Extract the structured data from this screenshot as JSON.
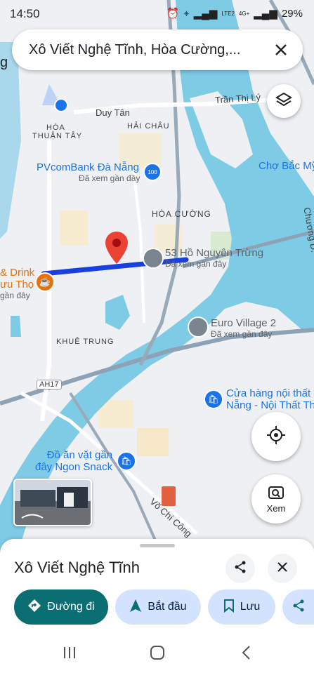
{
  "status": {
    "time": "14:50",
    "network": "LTE2",
    "network2": "4G+",
    "battery": "29%"
  },
  "search": {
    "query": "Xô Viết Nghệ Tĩnh, Hòa Cường,..."
  },
  "map": {
    "streets": [
      {
        "id": "duy-tan",
        "label": "Duy Tân"
      },
      {
        "id": "tran-thi-ly",
        "label": "Trần Thị Lý"
      },
      {
        "id": "vo-chi-cong",
        "label": "Võ Chí Công"
      },
      {
        "id": "chuong-d",
        "label": "Chương D."
      },
      {
        "id": "ah17",
        "label": "AH17"
      }
    ],
    "areas": [
      {
        "id": "hoa-thuan-tay-1",
        "label": "HÒA"
      },
      {
        "id": "hoa-thuan-tay-2",
        "label": "THUẬN TÂY"
      },
      {
        "id": "hai-chau",
        "label": "HẢI CHÂU"
      },
      {
        "id": "hoa-cuong",
        "label": "HÒA CƯỜNG"
      },
      {
        "id": "khue-trung",
        "label": "KHUÊ TRUNG"
      }
    ],
    "pois": [
      {
        "id": "pvcombank",
        "title": "PVcomBank Đà Nẵng",
        "subtitle": "Đã xem gần đây",
        "color": "#1a73e8"
      },
      {
        "id": "cho-bac-my",
        "title": "Chợ Bắc Mỹ",
        "color": "#1a73e8"
      },
      {
        "id": "53-ho-nguyen-trung",
        "title": "53 Hồ Nguyên Trừng",
        "subtitle": "Đã xem gần đây",
        "color": "#5f6368"
      },
      {
        "id": "drink-1",
        "title": "& Drink",
        "color": "#e8710a"
      },
      {
        "id": "drink-2",
        "title": "ưu Thọ",
        "color": "#e8710a"
      },
      {
        "id": "drink-3",
        "title": "gần đây",
        "color": "#5f6368"
      },
      {
        "id": "euro-village",
        "title": "Euro Village 2",
        "subtitle": "Đã xem gần đây",
        "color": "#5f6368"
      },
      {
        "id": "cua-hang-1",
        "title": "Cửa hàng nội thất",
        "color": "#1a73e8"
      },
      {
        "id": "cua-hang-2",
        "title": "Nẵng - Nội Thất Th",
        "color": "#1a73e8"
      },
      {
        "id": "do-an-vat-1",
        "title": "Đồ ăn vặt gần",
        "color": "#1a73e8"
      },
      {
        "id": "do-an-vat-2",
        "title": "đây Ngon Snack",
        "color": "#1a73e8"
      },
      {
        "id": "left-edge",
        "title": "g",
        "color": "#202124"
      }
    ],
    "street_view_label": "Xem"
  },
  "sheet": {
    "place_title": "Xô Viết Nghệ Tĩnh",
    "actions": [
      {
        "id": "directions",
        "label": "Đường đi",
        "icon": "directions-icon"
      },
      {
        "id": "start",
        "label": "Bắt đầu",
        "icon": "navigation-arrow-icon"
      },
      {
        "id": "save",
        "label": "Lưu",
        "icon": "bookmark-icon"
      }
    ]
  },
  "colors": {
    "accent": "#0b57d0",
    "primary_chip": "#0b6e72",
    "chip_bg": "#d3e3fd",
    "water": "#7ecbe6",
    "route": "#1a3fe0",
    "pin": "#ea4335"
  }
}
